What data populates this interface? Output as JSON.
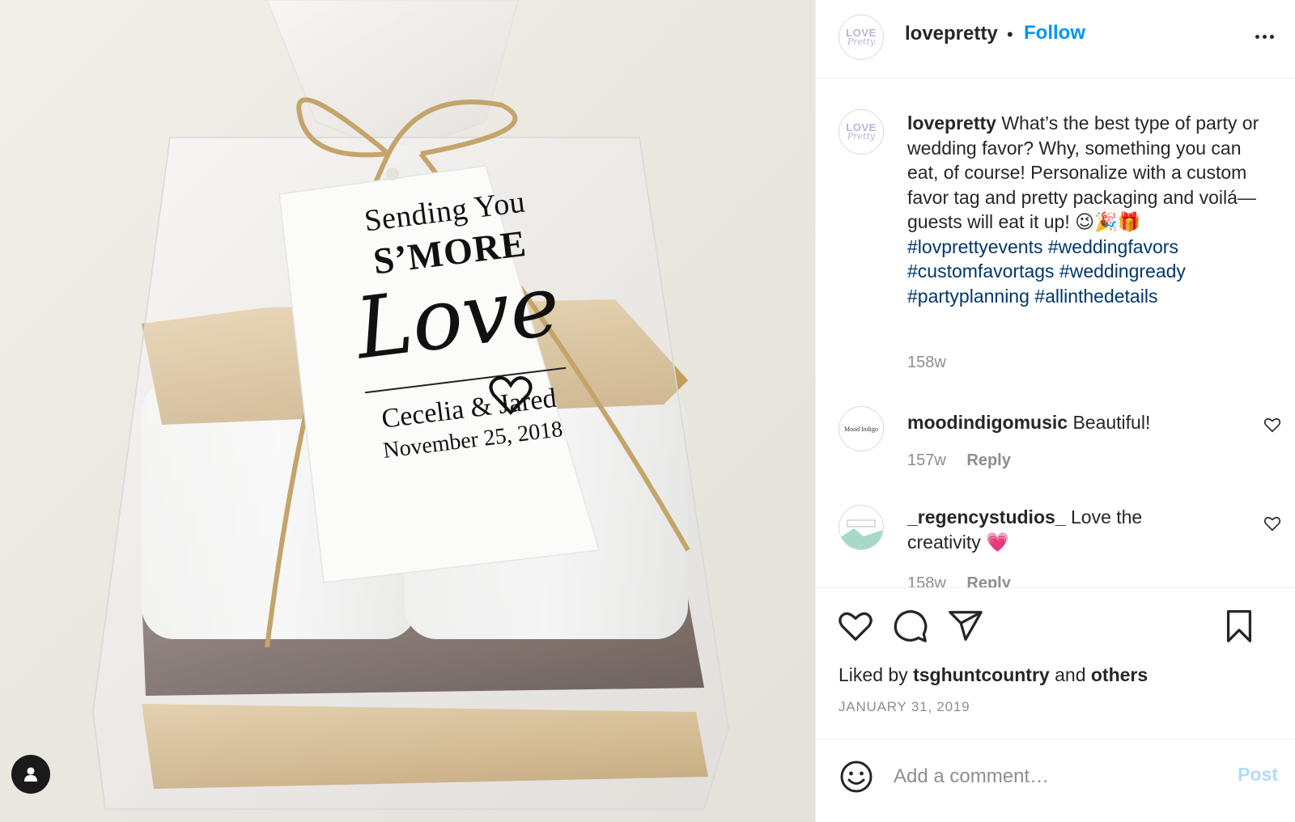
{
  "post": {
    "username": "lovepretty",
    "follow_label": "Follow",
    "avatar_text_top": "LOVE",
    "avatar_text_bottom": "Pretty",
    "photo_tag": {
      "line1": "Sending You",
      "line2": "S’MORE",
      "line3": "Love",
      "names": "Cecelia & Jared",
      "date": "November 25, 2018"
    }
  },
  "caption": {
    "username": "lovepretty",
    "text": "What’s the best type of party or wedding favor? Why, something you can eat, of course! Personalize with a custom favor tag and pretty packaging and voilá—guests will eat it up! 😉🎉🎁",
    "hashtags": "#lovprettyevents #weddingfavors #customfavortags #weddingready #partyplanning #allinthedetails",
    "age": "158w"
  },
  "comments": [
    {
      "username": "moodindigomusic",
      "avatar_text": "Mood Indigo",
      "text": "Beautiful!",
      "age": "157w",
      "reply_label": "Reply"
    },
    {
      "username": "_regencystudios_",
      "text": "Love the creativity 💗",
      "age": "158w",
      "reply_label": "Reply"
    }
  ],
  "likes": {
    "prefix": "Liked by",
    "user": "tsghuntcountry",
    "middle": "and",
    "others": "others"
  },
  "date": "JANUARY 31, 2019",
  "add_comment": {
    "placeholder": "Add a comment…",
    "post_label": "Post"
  },
  "colors": {
    "accent": "#0095f6",
    "hashtag": "#00376b",
    "muted": "#8e8e8e",
    "post_disabled": "#b3dbff"
  },
  "icons": [
    "heart-icon",
    "comment-icon",
    "share-icon",
    "bookmark-icon",
    "emoji-icon",
    "user-tag-icon",
    "more-icon"
  ]
}
